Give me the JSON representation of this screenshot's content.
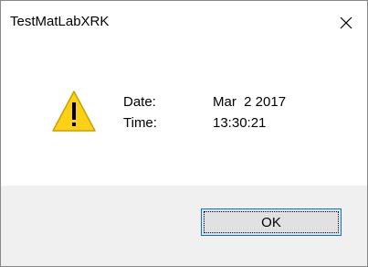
{
  "window": {
    "title": "TestMatLabXRK",
    "close_icon": "close-icon"
  },
  "message": {
    "icon": "warning-icon",
    "rows": [
      {
        "label": "Date:",
        "value": "Mar  2 2017"
      },
      {
        "label": "Time:",
        "value": "13:30:21"
      }
    ]
  },
  "buttons": {
    "ok_label": "OK"
  },
  "colors": {
    "warning_fill": "#fcd116",
    "warning_stroke": "#c9a100",
    "focus_border": "#0078d7",
    "footer_bg": "#f0f0f0"
  }
}
